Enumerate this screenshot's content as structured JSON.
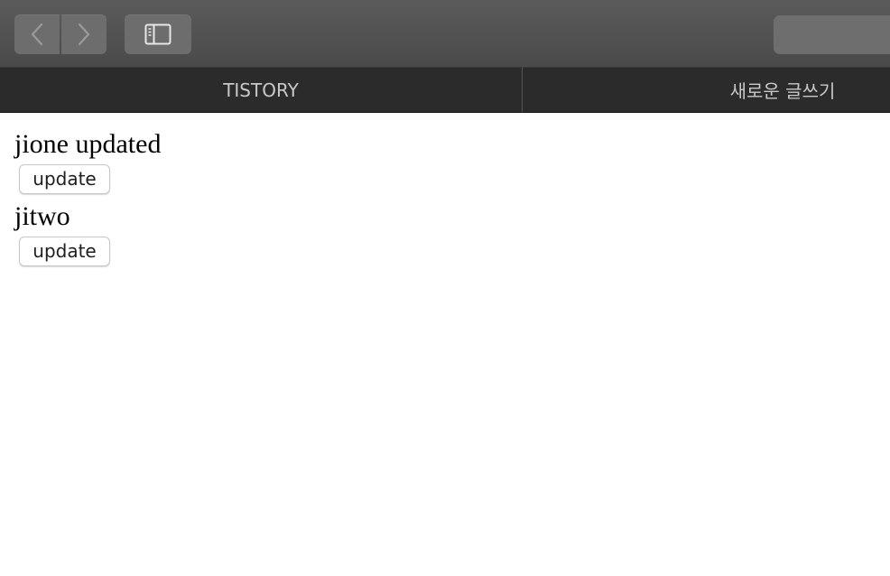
{
  "browser": {
    "icons": {
      "back": "chevron-left-icon",
      "forward": "chevron-right-icon",
      "sidebar": "sidebar-icon"
    },
    "tabs": [
      {
        "label": "TISTORY"
      },
      {
        "label": "새로운 글쓰기"
      }
    ]
  },
  "page": {
    "items": [
      {
        "text": "jione updated",
        "button_label": "update"
      },
      {
        "text": "jitwo",
        "button_label": "update"
      }
    ]
  },
  "colors": {
    "toolbar": "#535353",
    "tabbar": "#2b2b2b",
    "tab_text": "#c8c8c8",
    "page_background": "#ffffff"
  }
}
